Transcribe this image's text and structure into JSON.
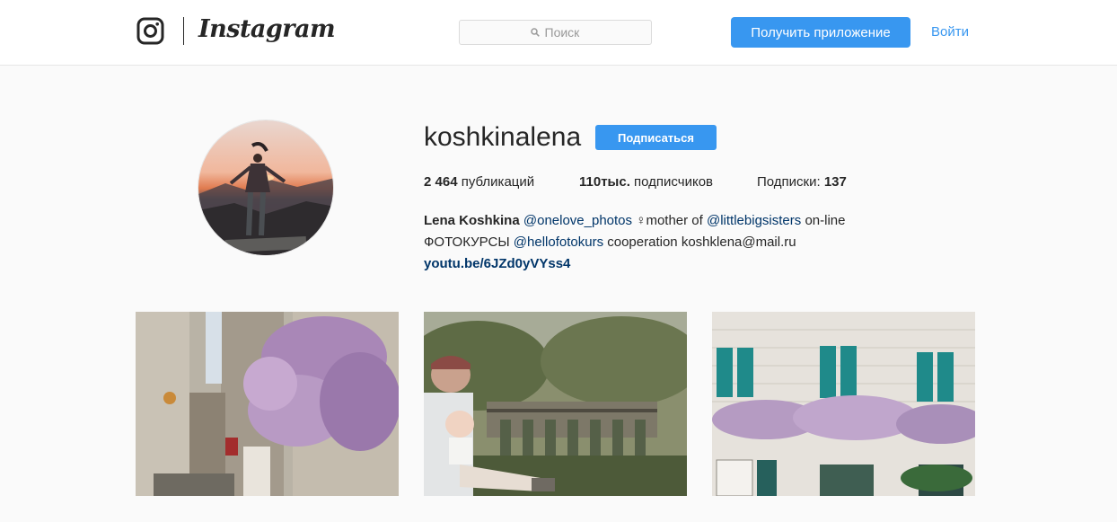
{
  "header": {
    "brand_wordmark": "Instagram",
    "search": {
      "placeholder": "Поиск",
      "icon": "search-icon"
    },
    "get_app_label": "Получить приложение",
    "login_label": "Войти",
    "accent_color": "#3897f0"
  },
  "profile": {
    "username": "koshkinalena",
    "follow_label": "Подписаться",
    "stats": {
      "posts_value": "2 464",
      "posts_label": "публикаций",
      "followers_value": "110тыс.",
      "followers_label": "подписчиков",
      "following_label": "Подписки:",
      "following_value": "137"
    },
    "bio": {
      "name": "Lena Koshkina",
      "glyph_1": "",
      "mention_1": "@onelove_photos",
      "glyph_2": "♀",
      "text_1": "mother of",
      "mention_2": "@littlebigsisters",
      "glyph_3": "",
      "text_2": "on-line",
      "text_3": "ФОТОКУРСЫ",
      "mention_3": "@hellofotokurs",
      "glyph_4": "",
      "text_4": "cooperation",
      "glyph_5": "",
      "email": "koshklena@mail.ru",
      "link": "youtu.be/6JZd0yVYss4"
    }
  },
  "posts": [
    {
      "subject": "stone alley with wisteria"
    },
    {
      "subject": "father and baby by viaduct"
    },
    {
      "subject": "house facade with teal shutters"
    }
  ]
}
